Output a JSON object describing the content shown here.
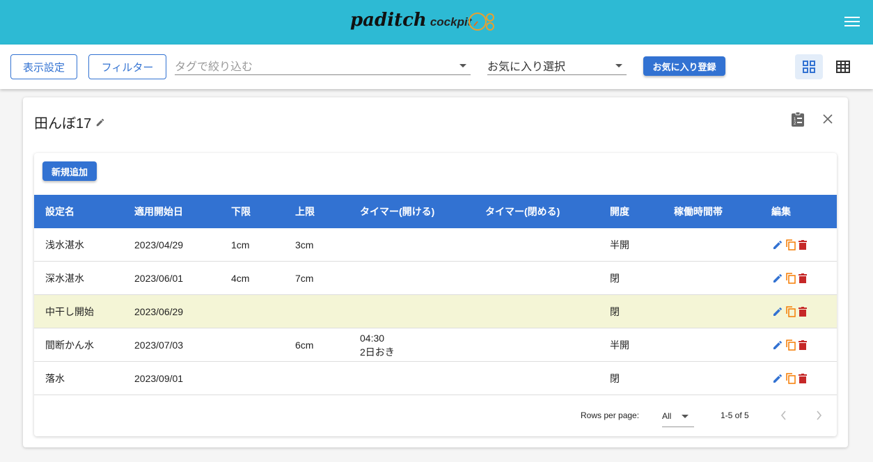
{
  "header": {
    "logo_main": "paditch",
    "logo_sub": "cockpit"
  },
  "toolbar": {
    "display_settings": "表示設定",
    "filter": "フィルター",
    "tag_placeholder": "タグで絞り込む",
    "favorite_select": "お気に入り選択",
    "favorite_register": "お気に入り登録"
  },
  "card": {
    "title": "田んぼ17",
    "add_button": "新規追加"
  },
  "table": {
    "headers": [
      "設定名",
      "適用開始日",
      "下限",
      "上限",
      "タイマー(開ける)",
      "タイマー(閉める)",
      "開度",
      "稼働時間帯",
      "編集"
    ],
    "rows": [
      [
        "浅水湛水",
        "2023/04/29",
        "1cm",
        "3cm",
        "",
        "",
        "半開",
        ""
      ],
      [
        "深水湛水",
        "2023/06/01",
        "4cm",
        "7cm",
        "",
        "",
        "閉",
        ""
      ],
      [
        "中干し開始",
        "2023/06/29",
        "",
        "",
        "",
        "",
        "閉",
        ""
      ],
      [
        "間断かん水",
        "2023/07/03",
        "",
        "6cm",
        "04:30\n2日おき",
        "",
        "半開",
        ""
      ],
      [
        "落水",
        "2023/09/01",
        "",
        "",
        "",
        "",
        "閉",
        ""
      ]
    ]
  },
  "footer": {
    "rows_per_page_label": "Rows per page:",
    "rows_per_page_value": "All",
    "range": "1-5 of 5"
  },
  "colors": {
    "appbar": "#2dbad4",
    "primary": "#3272d2",
    "highlight_row": "#f4f5d6",
    "copy": "#f57c00",
    "delete": "#c62828"
  }
}
